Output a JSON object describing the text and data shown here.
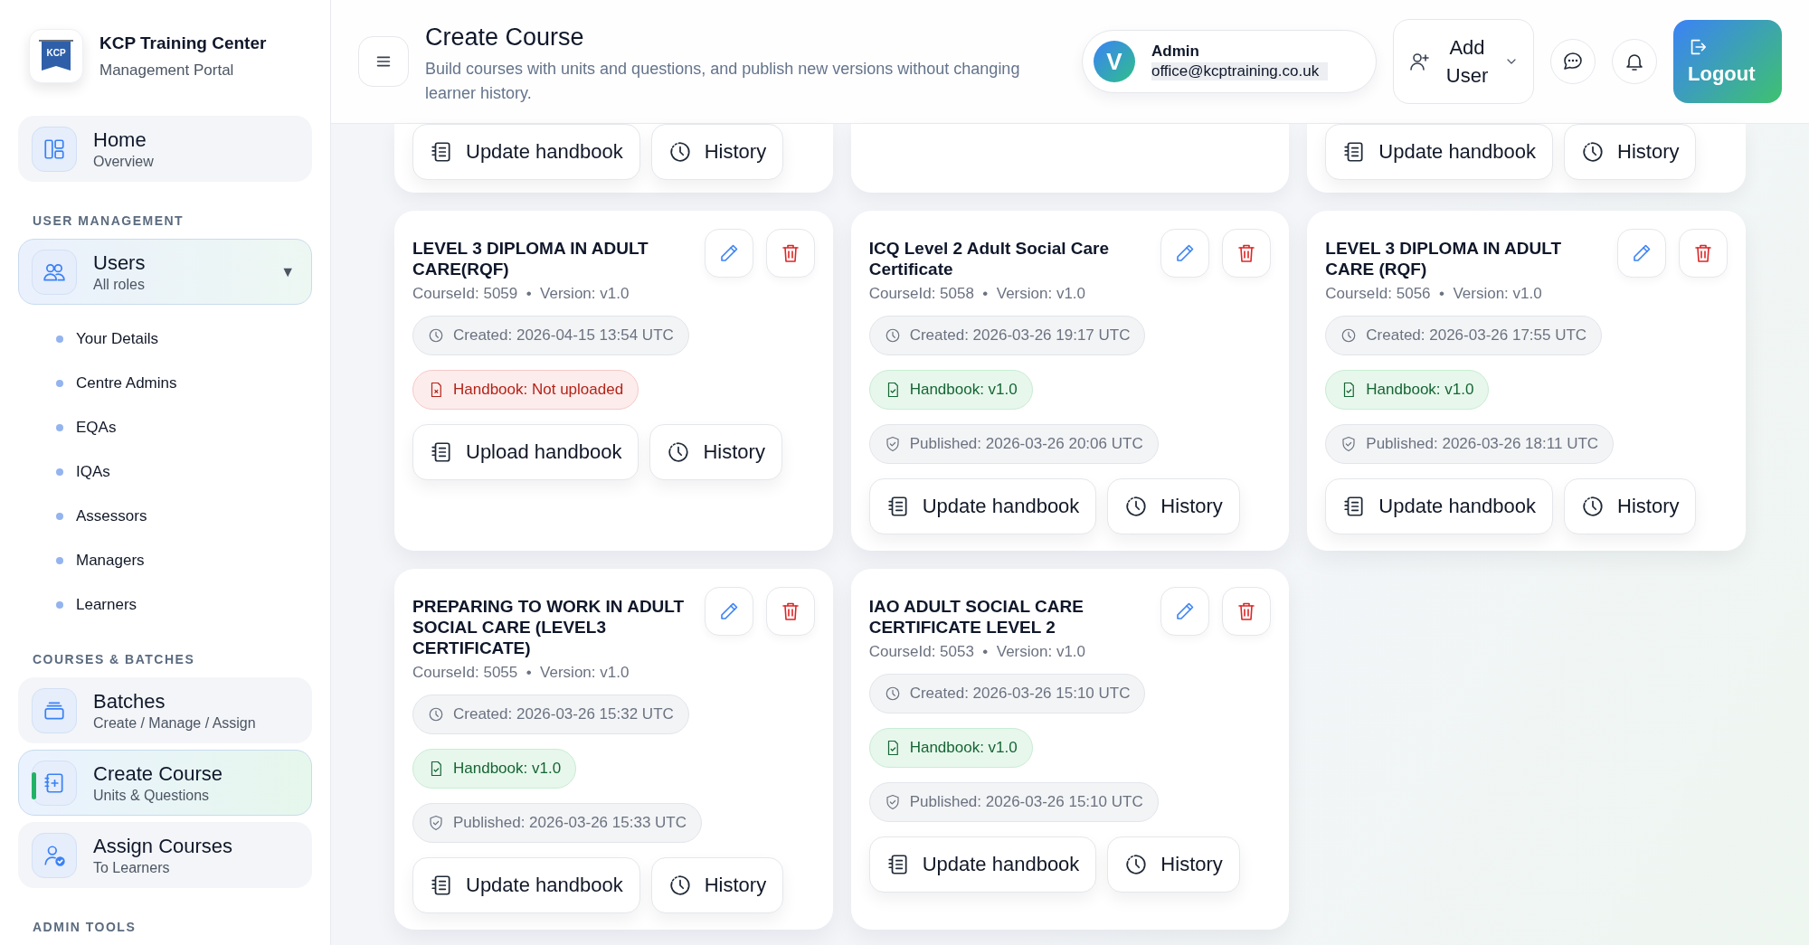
{
  "sidebar": {
    "brand": {
      "logo_text": "KCP",
      "title": "KCP Training Center",
      "subtitle": "Management Portal"
    },
    "sections": [
      {
        "items": [
          {
            "kind": "home",
            "label": "Home",
            "sublabel": "Overview",
            "selected": false
          }
        ]
      },
      {
        "label": "USER MANAGEMENT",
        "items": [
          {
            "kind": "users",
            "label": "Users",
            "sublabel": "All roles",
            "selected": false,
            "expanded": true,
            "toggle": "▼",
            "children": [
              {
                "label": "Your Details",
                "selected": false
              },
              {
                "label": "Centre Admins",
                "selected": false
              },
              {
                "label": "EQAs",
                "selected": false
              },
              {
                "label": "IQAs",
                "selected": false
              },
              {
                "label": "Assessors",
                "selected": false
              },
              {
                "label": "Managers",
                "selected": false
              },
              {
                "label": "Learners",
                "selected": false
              }
            ]
          }
        ]
      },
      {
        "label": "COURSES & BATCHES",
        "items": [
          {
            "kind": "batches",
            "label": "Batches",
            "sublabel": "Create / Manage / Assign",
            "selected": false
          },
          {
            "kind": "course",
            "label": "Create Course",
            "sublabel": "Units & Questions",
            "selected": true
          },
          {
            "kind": "assign",
            "label": "Assign Courses",
            "sublabel": "To Learners",
            "selected": false
          }
        ]
      },
      {
        "label": "ADMIN TOOLS"
      }
    ]
  },
  "header": {
    "title": "Create Course",
    "subtitle": "Build courses with units and questions, and publish new versions without changing learner history.",
    "user": {
      "avatar": "V",
      "name": "Admin",
      "email": "office@kcptraining.co.uk"
    },
    "add_user": "Add User",
    "logout": "Logout"
  },
  "cut_off_cards": [
    {
      "kind": "actions",
      "actions": [
        {
          "kind": "update",
          "label": "Update handbook"
        },
        {
          "kind": "history",
          "label": "History"
        }
      ]
    },
    {
      "kind": "blank"
    },
    {
      "kind": "actions",
      "actions": [
        {
          "kind": "update",
          "label": "Update handbook"
        },
        {
          "kind": "history",
          "label": "History"
        }
      ]
    }
  ],
  "courses": [
    {
      "title": "LEVEL 3 DIPLOMA IN ADULT CARE(RQF)",
      "meta": "CourseId: 5059  •  Version: v1.0",
      "created": "Created: 2026-04-15 13:54 UTC",
      "handbook": {
        "uploaded": false,
        "text": "Handbook: Not uploaded"
      },
      "actions": [
        {
          "kind": "upload",
          "label": "Upload handbook"
        },
        {
          "kind": "history",
          "label": "History"
        }
      ]
    },
    {
      "title": "ICQ Level 2 Adult Social Care Certificate",
      "meta": "CourseId: 5058  •  Version: v1.0",
      "created": "Created: 2026-03-26 19:17 UTC",
      "handbook": {
        "uploaded": true,
        "text": "Handbook: v1.0"
      },
      "published": "Published: 2026-03-26 20:06 UTC",
      "actions": [
        {
          "kind": "update",
          "label": "Update handbook"
        },
        {
          "kind": "history",
          "label": "History"
        }
      ]
    },
    {
      "title": "LEVEL 3 DIPLOMA IN ADULT CARE (RQF)",
      "meta": "CourseId: 5056  •  Version: v1.0",
      "created": "Created: 2026-03-26 17:55 UTC",
      "handbook": {
        "uploaded": true,
        "text": "Handbook: v1.0"
      },
      "published": "Published: 2026-03-26 18:11 UTC",
      "actions": [
        {
          "kind": "update",
          "label": "Update handbook"
        },
        {
          "kind": "history",
          "label": "History"
        }
      ]
    },
    {
      "title": "PREPARING TO WORK IN ADULT SOCIAL CARE (LEVEL3 CERTIFICATE)",
      "meta": "CourseId: 5055  •  Version: v1.0",
      "created": "Created: 2026-03-26 15:32 UTC",
      "handbook": {
        "uploaded": true,
        "text": "Handbook: v1.0"
      },
      "published": "Published: 2026-03-26 15:33 UTC",
      "actions": [
        {
          "kind": "update",
          "label": "Update handbook"
        },
        {
          "kind": "history",
          "label": "History"
        }
      ]
    },
    {
      "title": "IAO ADULT SOCIAL CARE CERTIFICATE LEVEL 2",
      "meta": "CourseId: 5053  •  Version: v1.0",
      "created": "Created: 2026-03-26 15:10 UTC",
      "handbook": {
        "uploaded": true,
        "text": "Handbook: v1.0"
      },
      "published": "Published: 2026-03-26 15:10 UTC",
      "actions": [
        {
          "kind": "update",
          "label": "Update handbook"
        },
        {
          "kind": "history",
          "label": "History"
        }
      ]
    }
  ]
}
